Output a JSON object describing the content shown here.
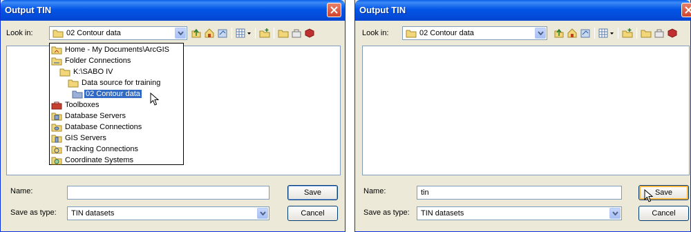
{
  "left_dialog": {
    "title": "Output TIN",
    "look_in_label": "Look in:",
    "look_in_value": "02 Contour data",
    "dropdown_items": [
      {
        "label": "Home - My Documents\\ArcGIS",
        "icon": "home-folder-icon"
      },
      {
        "label": "Folder Connections",
        "icon": "folder-connections-icon"
      },
      {
        "label": "K:\\SABO IV",
        "icon": "folder-icon"
      },
      {
        "label": "Data source for training",
        "icon": "folder-icon"
      },
      {
        "label": "02 Contour data",
        "icon": "folder-icon",
        "selected": true
      },
      {
        "label": "Toolboxes",
        "icon": "toolbox-icon"
      },
      {
        "label": "Database Servers",
        "icon": "database-server-icon"
      },
      {
        "label": "Database Connections",
        "icon": "database-connection-icon"
      },
      {
        "label": "GIS Servers",
        "icon": "gis-server-icon"
      },
      {
        "label": "Tracking Connections",
        "icon": "tracking-connection-icon"
      },
      {
        "label": "Coordinate Systems",
        "icon": "coordinate-system-icon"
      }
    ],
    "name_label": "Name:",
    "name_value": "",
    "type_label": "Save as type:",
    "type_value": "TIN datasets",
    "save_label": "Save",
    "cancel_label": "Cancel"
  },
  "right_dialog": {
    "title": "Output TIN",
    "look_in_label": "Look in:",
    "look_in_value": "02 Contour data",
    "name_label": "Name:",
    "name_value": "tin",
    "type_label": "Save as type:",
    "type_value": "TIN datasets",
    "save_label": "Save",
    "cancel_label": "Cancel"
  },
  "toolbar_icons": [
    "up-one-level-icon",
    "home-icon",
    "connect-folder-icon",
    "view-menu-icon",
    "new-folder-icon",
    "folder-icon",
    "toolbox-icon",
    "delete-icon"
  ],
  "colors": {
    "title_bar": "#0355e6",
    "dialog_bg": "#ece9d8",
    "selection": "#316ac5",
    "border": "#7f9db9"
  }
}
